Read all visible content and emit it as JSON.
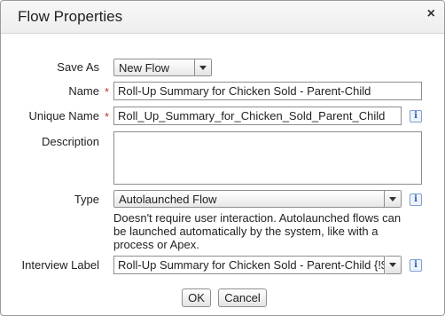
{
  "dialog": {
    "title": "Flow Properties",
    "close_glyph": "×"
  },
  "fields": {
    "save_as": {
      "label": "Save As",
      "value": "New Flow"
    },
    "name": {
      "label": "Name",
      "value": "Roll-Up Summary for Chicken Sold - Parent-Child",
      "required_marker": "*"
    },
    "unique_name": {
      "label": "Unique Name",
      "value": "Roll_Up_Summary_for_Chicken_Sold_Parent_Child",
      "required_marker": "*"
    },
    "description": {
      "label": "Description",
      "value": ""
    },
    "type": {
      "label": "Type",
      "value": "Autolaunched Flow",
      "help": "Doesn't require user interaction. Autolaunched flows can be launched automatically by the system, like with a process or Apex."
    },
    "interview_label": {
      "label": "Interview Label",
      "value": "Roll-Up Summary for Chicken Sold - Parent-Child  {!$Flow"
    }
  },
  "buttons": {
    "ok": "OK",
    "cancel": "Cancel"
  },
  "icons": {
    "info": "i",
    "info_icon_name": "info-icon",
    "close_icon_name": "close-icon"
  },
  "colors": {
    "required": "#c0392b",
    "info_border": "#7f9fd1"
  }
}
